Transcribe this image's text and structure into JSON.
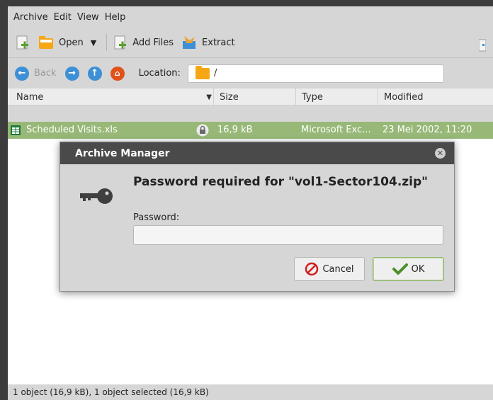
{
  "menu": [
    "Archive",
    "Edit",
    "View",
    "Help"
  ],
  "toolbar": {
    "open": "Open",
    "add_files": "Add Files",
    "extract": "Extract"
  },
  "navigation": {
    "back": "Back",
    "location_label": "Location:",
    "location_value": "/"
  },
  "columns": {
    "name": "Name",
    "size": "Size",
    "type": "Type",
    "modified": "Modified"
  },
  "file": {
    "name": "Scheduled Visits.xls",
    "size": "16,9 kB",
    "type": "Microsoft Exc...",
    "modified": "23 Mei 2002, 11:20"
  },
  "statusbar": {
    "text": "1 object (16,9 kB), 1 object selected (16,9 kB)"
  },
  "dialog": {
    "title": "Archive Manager",
    "heading": "Password required for \"vol1-Sector104.zip\"",
    "password_label": "Password:",
    "password_value": "",
    "cancel": "Cancel",
    "ok": "OK"
  },
  "colors": {
    "selection": "#97b877",
    "accent_blue": "#3d8fd6",
    "home_orange": "#e0521a",
    "folder": "#f7a614"
  }
}
